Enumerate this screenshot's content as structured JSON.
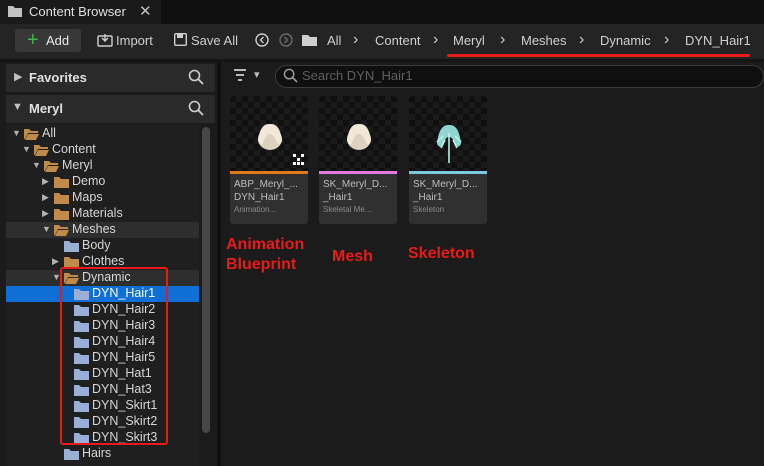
{
  "tab": {
    "title": "Content Browser",
    "close": "✕"
  },
  "toolbar": {
    "add_label": "Add",
    "add_symbol": "+",
    "import_label": "Import",
    "save_all_label": "Save All"
  },
  "breadcrumb": [
    "All",
    "Content",
    "Meryl",
    "Meshes",
    "Dynamic",
    "DYN_Hair1"
  ],
  "panels": {
    "favorites": "Favorites",
    "source": "Meryl"
  },
  "tree": [
    {
      "label": "All",
      "depth": 0,
      "expanded": true
    },
    {
      "label": "Content",
      "depth": 1,
      "expanded": true
    },
    {
      "label": "Meryl",
      "depth": 2,
      "expanded": true
    },
    {
      "label": "Demo",
      "depth": 3,
      "expanded": false
    },
    {
      "label": "Maps",
      "depth": 3,
      "expanded": false
    },
    {
      "label": "Materials",
      "depth": 3,
      "expanded": false
    },
    {
      "label": "Meshes",
      "depth": 3,
      "expanded": true
    },
    {
      "label": "Body",
      "depth": 4,
      "leaf": true
    },
    {
      "label": "Clothes",
      "depth": 4,
      "expanded": false
    },
    {
      "label": "Dynamic",
      "depth": 4,
      "expanded": true
    },
    {
      "label": "DYN_Hair1",
      "depth": 5,
      "leaf": true,
      "selected": true
    },
    {
      "label": "DYN_Hair2",
      "depth": 5,
      "leaf": true
    },
    {
      "label": "DYN_Hair3",
      "depth": 5,
      "leaf": true
    },
    {
      "label": "DYN_Hair4",
      "depth": 5,
      "leaf": true
    },
    {
      "label": "DYN_Hair5",
      "depth": 5,
      "leaf": true
    },
    {
      "label": "DYN_Hat1",
      "depth": 5,
      "leaf": true
    },
    {
      "label": "DYN_Hat3",
      "depth": 5,
      "leaf": true
    },
    {
      "label": "DYN_Skirt1",
      "depth": 5,
      "leaf": true
    },
    {
      "label": "DYN_Skirt2",
      "depth": 5,
      "leaf": true
    },
    {
      "label": "DYN_Skirt3",
      "depth": 5,
      "leaf": true
    },
    {
      "label": "Hairs",
      "depth": 4,
      "leaf": true
    }
  ],
  "search": {
    "placeholder": "Search DYN_Hair1"
  },
  "assets": [
    {
      "name1": "ABP_Meryl_...",
      "name2": "DYN_Hair1",
      "type": "Animation...",
      "accent": "#e07a1a",
      "icon": "hair-preview"
    },
    {
      "name1": "SK_Meryl_D...",
      "name2": "_Hair1",
      "type": "Skeletal Me...",
      "accent": "#e27ce0",
      "icon": "hair-preview"
    },
    {
      "name1": "SK_Meryl_D...",
      "name2": "_Hair1",
      "type": "Skeleton",
      "accent": "#7fc8e0",
      "icon": "skeleton-preview"
    }
  ],
  "annotations": [
    {
      "lines": [
        "Animation",
        "Blueprint"
      ]
    },
    {
      "lines": [
        "Mesh"
      ]
    },
    {
      "lines": [
        "Skeleton"
      ]
    }
  ],
  "colors": {
    "accent_red": "#e81a1a",
    "selection": "#0e70d6",
    "add_green": "#43b649",
    "folder": "#c08a4a",
    "folder_leaf": "#9aaed6"
  }
}
